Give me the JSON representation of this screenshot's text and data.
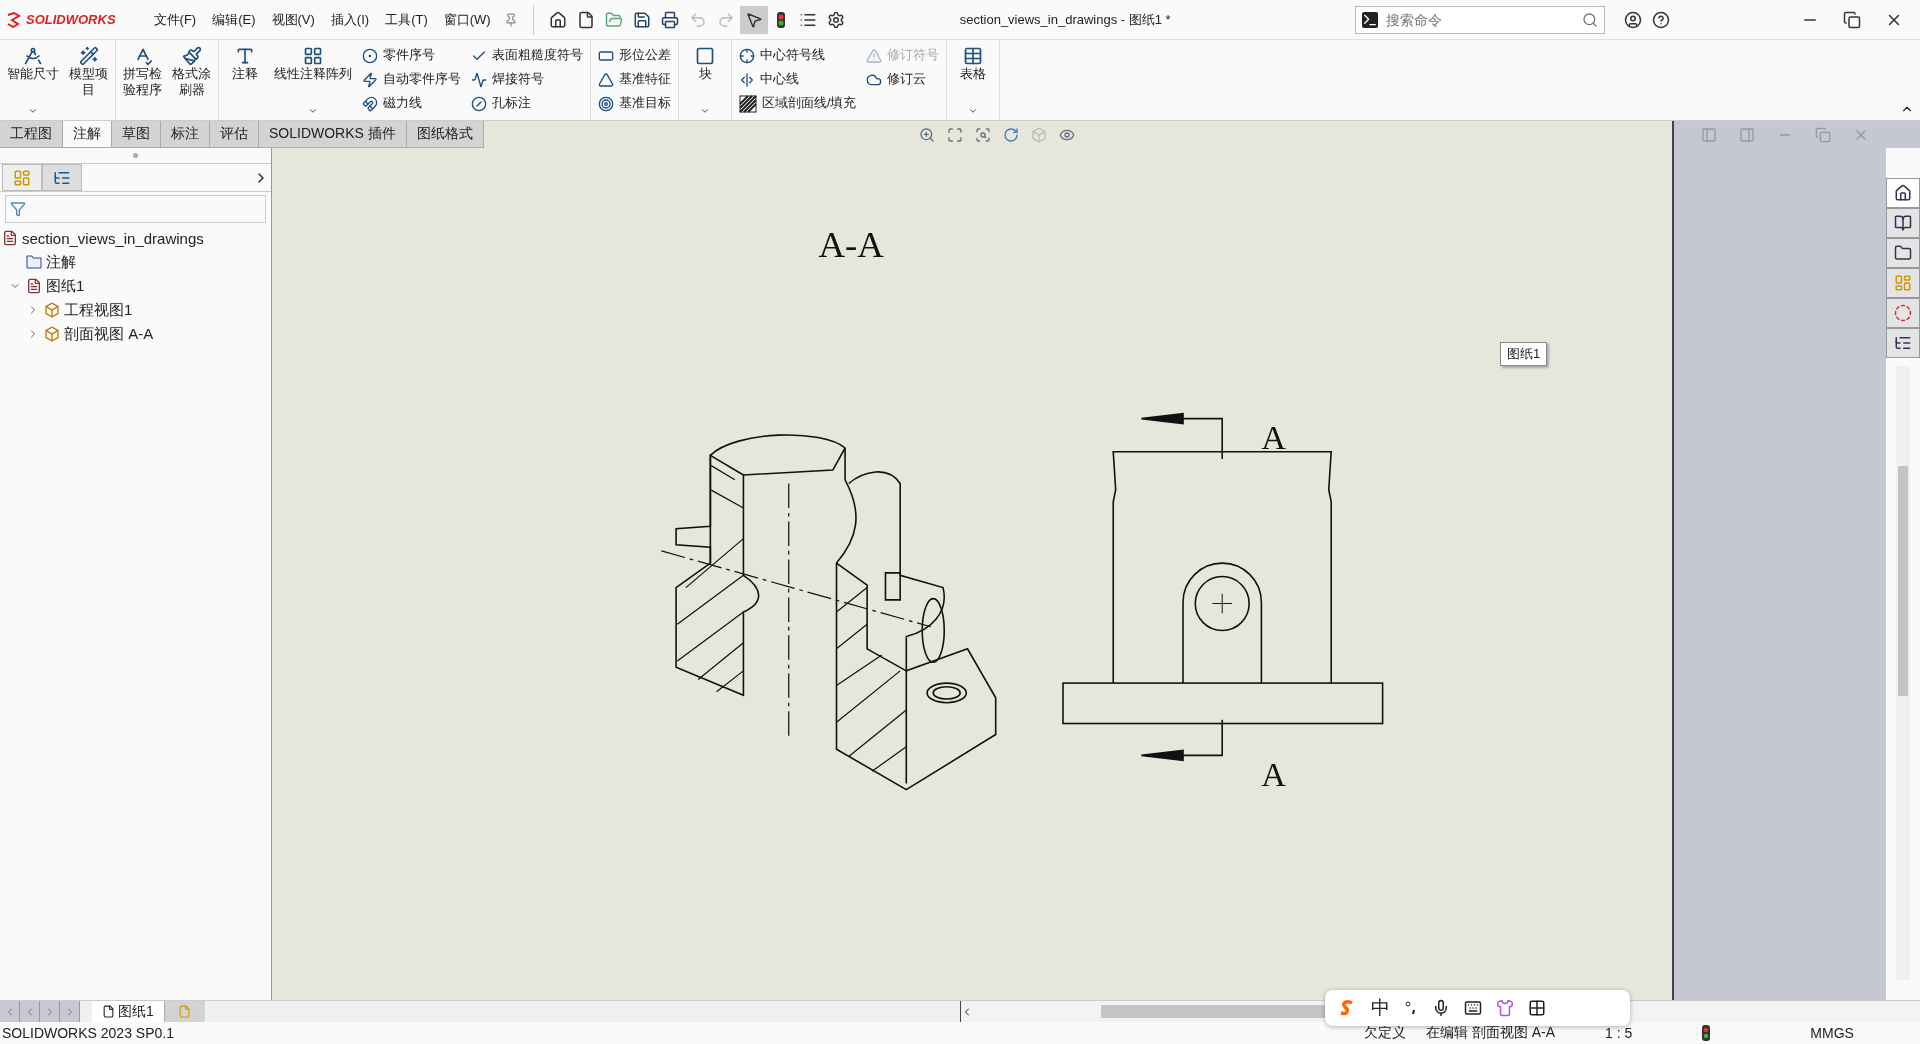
{
  "title_bar": {
    "logo": "SOLIDWORKS",
    "menu": [
      "文件(F)",
      "编辑(E)",
      "视图(V)",
      "插入(I)",
      "工具(T)",
      "窗口(W)"
    ],
    "document_title": "section_views_in_drawings - 图纸1 *",
    "search": {
      "placeholder": "搜索命令"
    }
  },
  "ribbon": {
    "groups": [
      {
        "items": [
          {
            "kind": "large",
            "lines": [
              "智能尺寸"
            ],
            "dropdown": true
          },
          {
            "kind": "large",
            "lines": [
              "模型项",
              "目"
            ],
            "dropdown": false
          }
        ]
      },
      {
        "items": [
          {
            "kind": "large",
            "lines": [
              "拼写检",
              "验程序"
            ],
            "dropdown": false
          },
          {
            "kind": "large",
            "lines": [
              "格式涂",
              "刷器"
            ],
            "dropdown": false
          }
        ]
      },
      {
        "items": [
          {
            "kind": "large",
            "lines": [
              "注释"
            ],
            "dropdown": false
          },
          {
            "kind": "large",
            "lines": [
              "线性注释阵列"
            ],
            "dropdown": true
          },
          {
            "kind": "column",
            "items": [
              {
                "label": "零件序号",
                "disabled": false
              },
              {
                "label": "自动零件序号",
                "disabled": false
              },
              {
                "label": "磁力线",
                "disabled": false
              }
            ]
          },
          {
            "kind": "column",
            "items": [
              {
                "label": "表面粗糙度符号",
                "disabled": false
              },
              {
                "label": "焊接符号",
                "disabled": false
              },
              {
                "label": "孔标注",
                "disabled": false
              }
            ]
          }
        ]
      },
      {
        "items": [
          {
            "kind": "column",
            "items": [
              {
                "label": "形位公差",
                "disabled": false
              },
              {
                "label": "基准特征",
                "disabled": false
              },
              {
                "label": "基准目标",
                "disabled": false
              }
            ]
          }
        ]
      },
      {
        "items": [
          {
            "kind": "large",
            "lines": [
              "块"
            ],
            "dropdown": true
          }
        ]
      },
      {
        "items": [
          {
            "kind": "column",
            "items": [
              {
                "label": "中心符号线",
                "disabled": false
              },
              {
                "label": "中心线",
                "disabled": false
              },
              {
                "label": "区域剖面线/填充",
                "disabled": false
              }
            ]
          },
          {
            "kind": "column",
            "items": [
              {
                "label": "修订符号",
                "disabled": true
              },
              {
                "label": "修订云",
                "disabled": false
              }
            ]
          }
        ]
      },
      {
        "items": [
          {
            "kind": "large",
            "lines": [
              "表格"
            ],
            "dropdown": true
          }
        ]
      }
    ]
  },
  "tabs": [
    {
      "label": "工程图",
      "selected": false
    },
    {
      "label": "注解",
      "selected": true
    },
    {
      "label": "草图",
      "selected": false
    },
    {
      "label": "标注",
      "selected": false
    },
    {
      "label": "评估",
      "selected": false
    },
    {
      "label": "SOLIDWORKS 插件",
      "selected": false
    },
    {
      "label": "图纸格式",
      "selected": false
    }
  ],
  "tree": {
    "root": "section_views_in_drawings",
    "children": [
      {
        "label": "注解",
        "kind": "annotations"
      },
      {
        "label": "图纸1",
        "kind": "sheet",
        "expanded": true,
        "children": [
          {
            "label": "工程视图1",
            "kind": "view",
            "expanded": false
          },
          {
            "label": "剖面视图 A-A",
            "kind": "view",
            "expanded": false
          }
        ]
      }
    ]
  },
  "task_pane_tabs": [
    {
      "selected": true
    },
    {
      "selected": false
    },
    {
      "selected": false
    },
    {
      "selected": false
    },
    {
      "selected": false
    },
    {
      "selected": false
    }
  ],
  "drawing": {
    "view_title": "A-A",
    "section_label_top": "A",
    "section_label_bottom": "A",
    "sheet_tag": "图纸1"
  },
  "sheet_tabs": [
    {
      "label": "图纸1",
      "selected": true
    }
  ],
  "ime": {
    "mode": "中"
  },
  "status_bar": {
    "version": "SOLIDWORKS 2023 SP0.1",
    "state": "欠定义",
    "editing": "在编辑 剖面视图 A-A",
    "scale": "1 : 5",
    "units": "MMGS"
  }
}
